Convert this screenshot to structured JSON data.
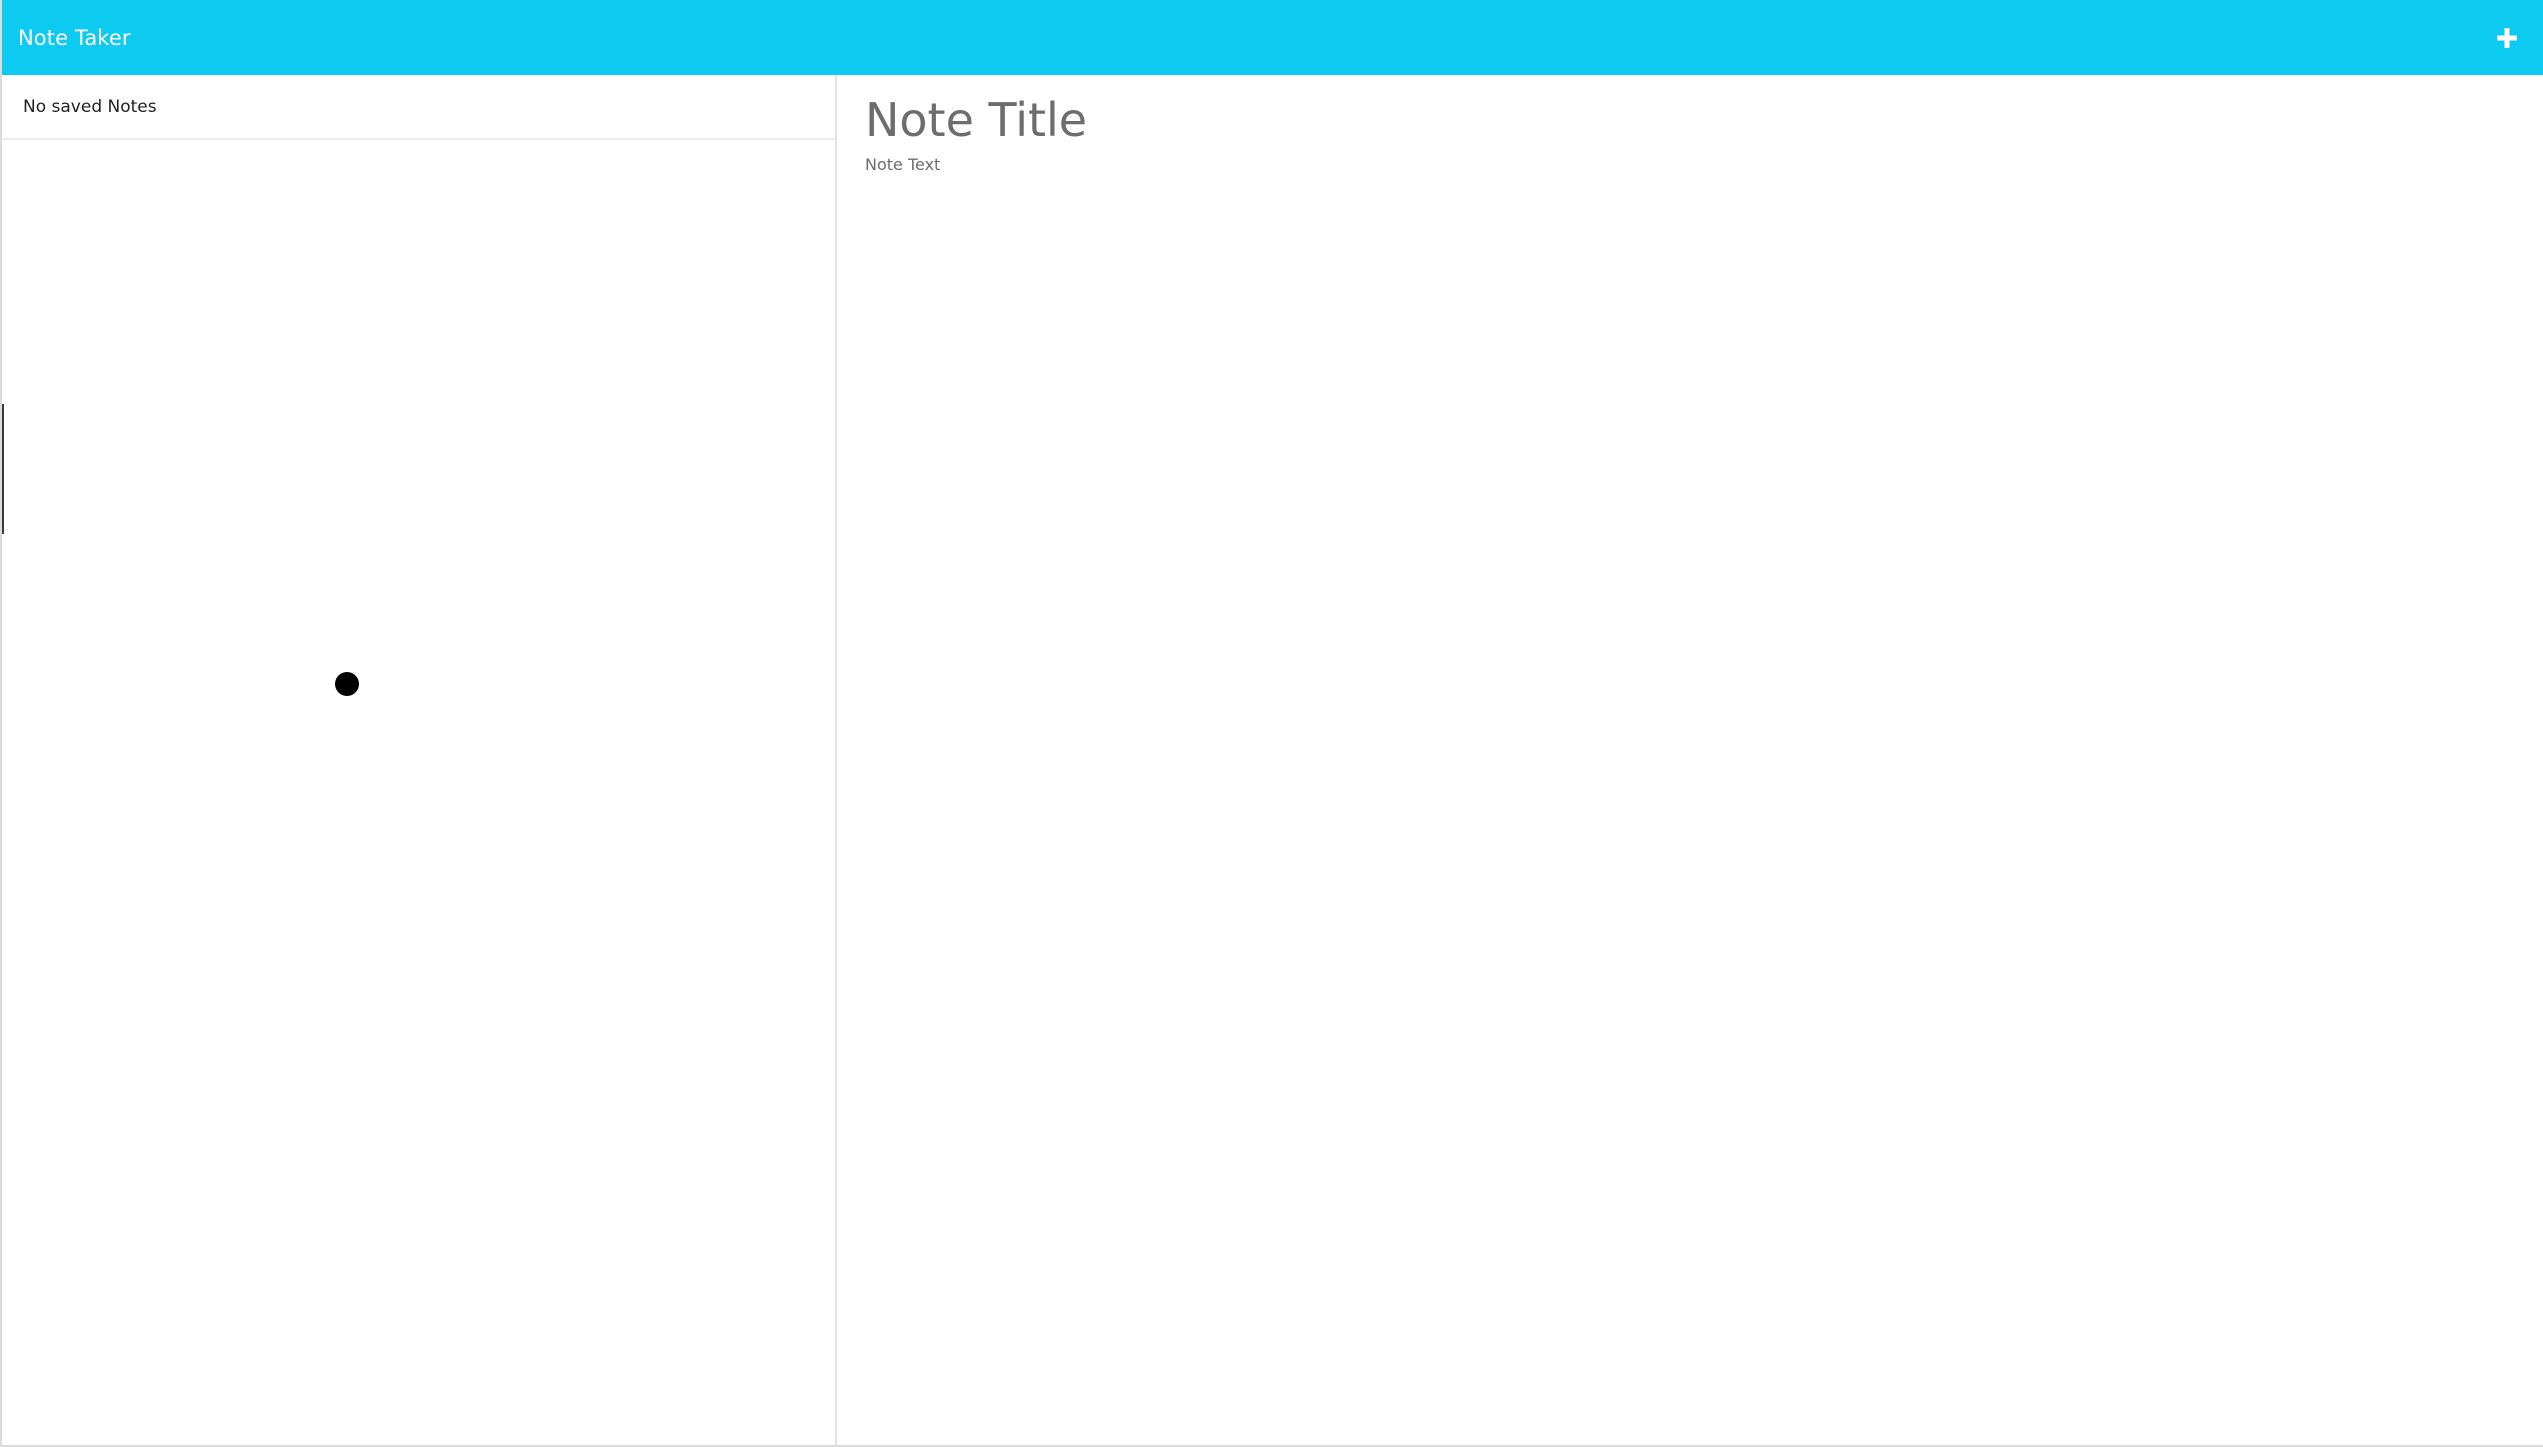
{
  "navbar": {
    "brand": "Note Taker",
    "new_note_icon": "plus-icon",
    "bg_color": "#0dcaf0"
  },
  "sidebar": {
    "empty_message": "No saved Notes"
  },
  "editor": {
    "title_placeholder": "Note Title",
    "text_placeholder": "Note Text"
  }
}
